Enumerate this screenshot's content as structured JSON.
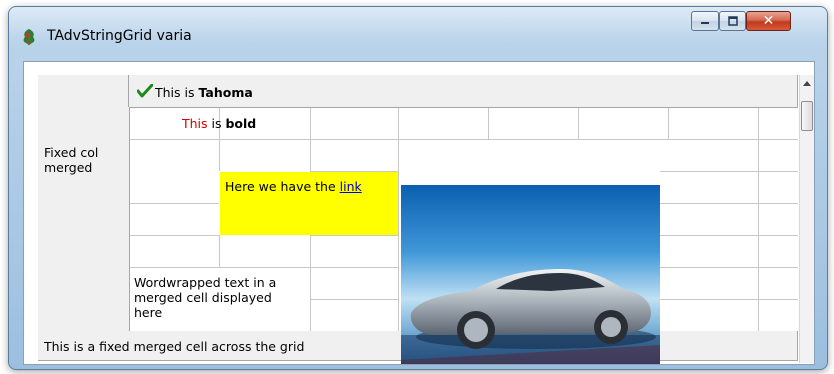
{
  "window": {
    "title": "TAdvStringGrid varia",
    "icon": "app-icon",
    "buttons": {
      "minimize": "minimize-icon",
      "maximize": "maximize-icon",
      "close": "close-icon"
    }
  },
  "grid": {
    "header_text_prefix": "This is ",
    "header_text_bold": "Tahoma",
    "check_icon": "checkmark-icon",
    "bold_text_red": "This",
    "bold_text_mid": " is ",
    "bold_text_bold": "bold",
    "fixed_col_merged": "Fixed col merged",
    "link_prefix": "Here we have the ",
    "link_text": "link",
    "wordwrapped": "Wordwrapped text in a merged cell displayed here",
    "fixed_row_merged": "This is a fixed merged cell across the grid",
    "image": "car-image",
    "colors": {
      "highlight": "#ffff00",
      "red_text": "#d40000",
      "fixed_bg": "#f0f0f0"
    }
  }
}
